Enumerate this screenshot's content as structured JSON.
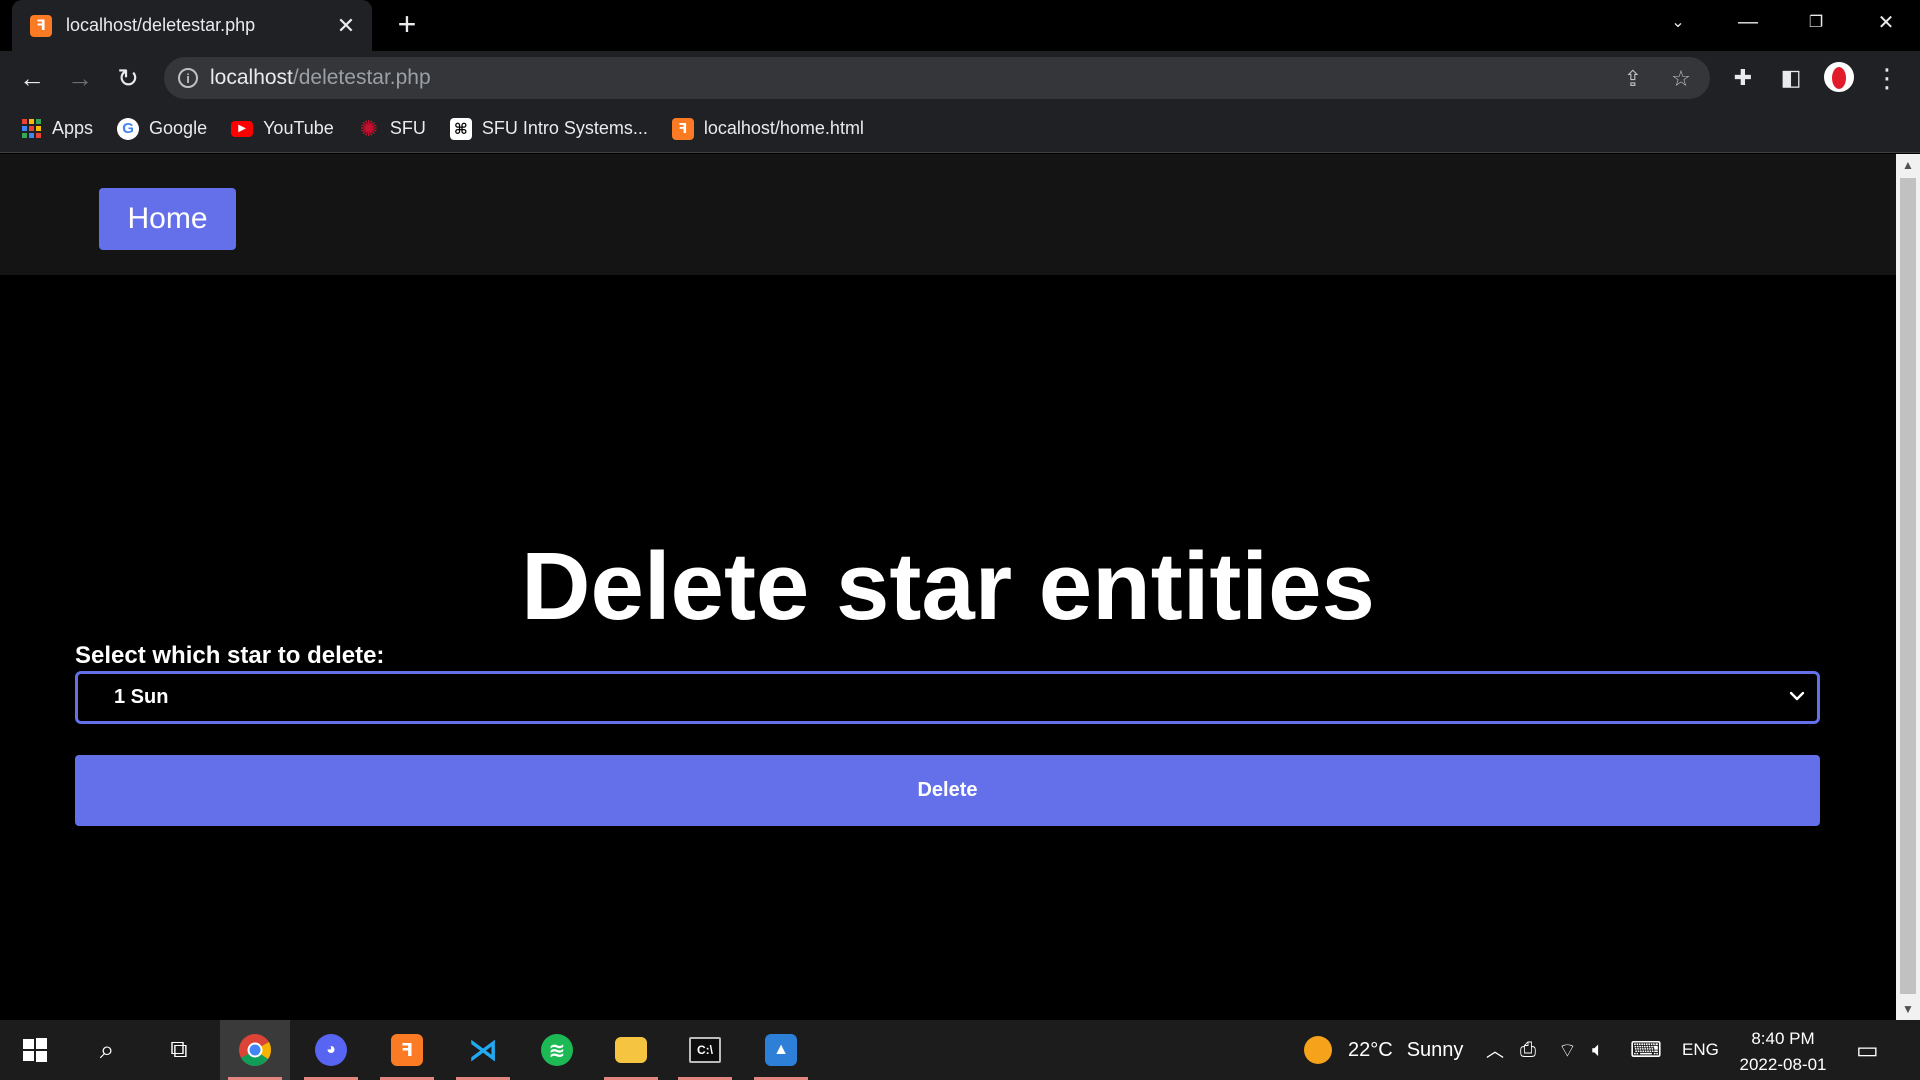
{
  "browser": {
    "tab_title": "localhost/deletestar.php",
    "tab_favicon": "xampp-icon",
    "url_host": "localhost",
    "url_path": "/deletestar.php",
    "bookmarks": [
      {
        "label": "Apps",
        "icon": "apps-icon"
      },
      {
        "label": "Google",
        "icon": "google-icon"
      },
      {
        "label": "YouTube",
        "icon": "youtube-icon"
      },
      {
        "label": "SFU",
        "icon": "sfu-icon"
      },
      {
        "label": "SFU Intro Systems...",
        "icon": "sfu-systems-icon"
      },
      {
        "label": "localhost/home.html",
        "icon": "xampp-icon"
      }
    ]
  },
  "page": {
    "nav": {
      "home_label": "Home"
    },
    "title": "Delete star entities",
    "select_label": "Select which star to delete:",
    "select_value": "1 Sun",
    "delete_label": "Delete",
    "colors": {
      "accent": "#6370e9",
      "background": "#000000",
      "navbar": "#141414"
    }
  },
  "taskbar": {
    "weather": {
      "temperature": "22°C",
      "condition": "Sunny"
    },
    "language": "ENG",
    "time": "8:40 PM",
    "date": "2022-08-01"
  }
}
